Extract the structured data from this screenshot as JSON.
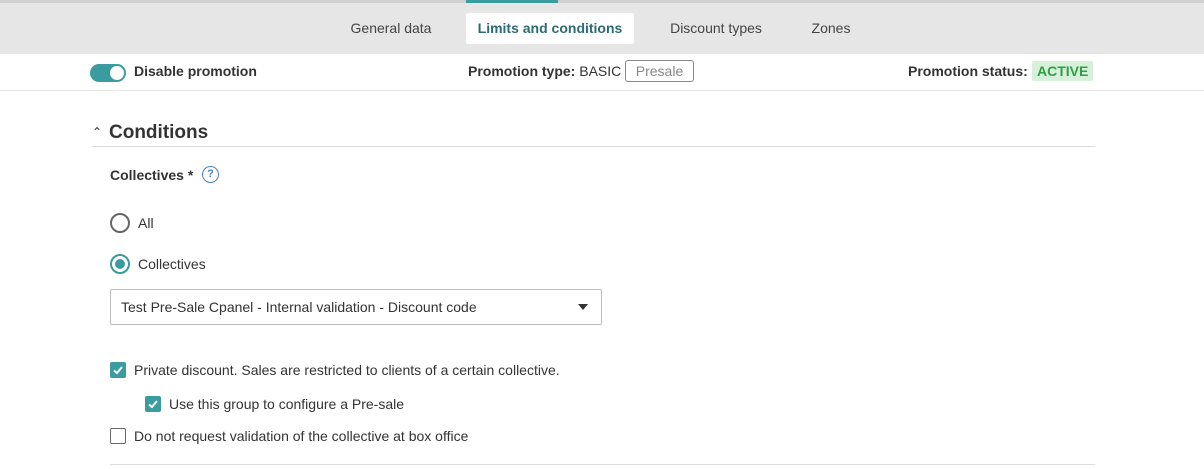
{
  "tabs": [
    {
      "label": "General data",
      "active": false
    },
    {
      "label": "Limits and conditions",
      "active": true
    },
    {
      "label": "Discount types",
      "active": false
    },
    {
      "label": "Zones",
      "active": false
    }
  ],
  "status_bar": {
    "toggle_label": "Disable promotion",
    "toggle_on": true,
    "promotion_type_label": "Promotion type:",
    "promotion_type_value": "BASIC",
    "presale_badge": "Presale",
    "promotion_status_label": "Promotion status:",
    "promotion_status_value": "ACTIVE"
  },
  "conditions": {
    "title": "Conditions",
    "collectives_label": "Collectives *",
    "help_glyph": "?",
    "radio_options": [
      {
        "label": "All",
        "checked": false
      },
      {
        "label": "Collectives",
        "checked": true
      }
    ],
    "collective_select_value": "Test Pre-Sale Cpanel - Internal validation - Discount code",
    "checkboxes": [
      {
        "label": "Private discount. Sales are restricted to clients of a certain collective.",
        "checked": true
      },
      {
        "label": "Use this group to configure a Pre-sale",
        "checked": true
      },
      {
        "label": "Do not request validation of the collective at box office",
        "checked": false
      }
    ]
  },
  "colors": {
    "accent": "#3a9c9f",
    "active_tab_text": "#2b6b73",
    "status_badge_bg": "#d7f0da",
    "status_badge_text": "#2f9e44",
    "help_icon": "#4a7fd4"
  }
}
